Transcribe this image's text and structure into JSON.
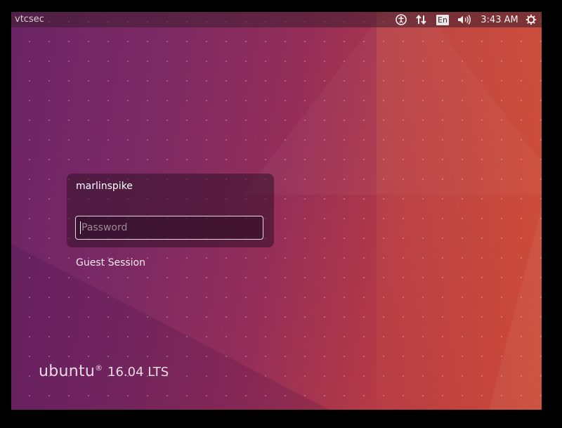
{
  "panel": {
    "hostname": "vtcsec",
    "keyboard_layout": "En",
    "clock": "3:43 AM",
    "icons": [
      "accessibility-icon",
      "network-icon",
      "keyboard-layout-indicator",
      "sound-icon",
      "power-icon"
    ]
  },
  "login": {
    "username": "marlinspike",
    "password_placeholder": "Password",
    "password_value": "",
    "guest_session_label": "Guest Session"
  },
  "branding": {
    "logo_text": "ubuntu",
    "logo_mark": "®",
    "version": "16.04 LTS"
  },
  "colors": {
    "wallpaper_left": "#6b2466",
    "wallpaper_right": "#cc4a36",
    "panel_text": "#e9e4e6"
  }
}
